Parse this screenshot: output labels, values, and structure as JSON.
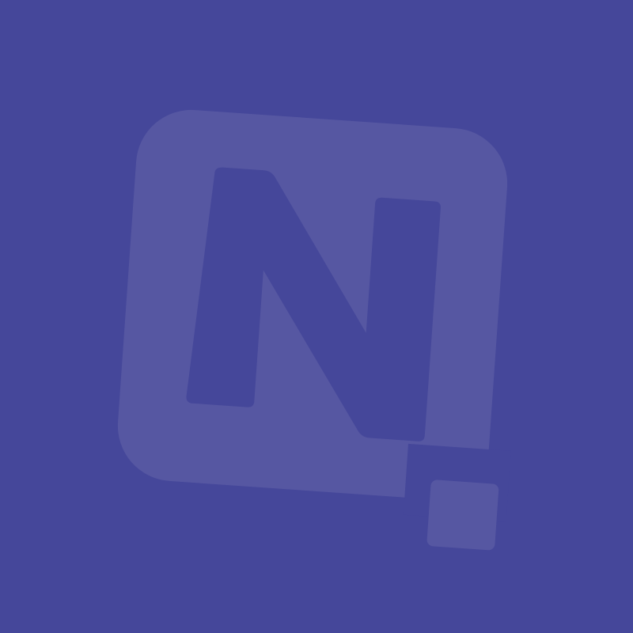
{
  "colors": {
    "background": "#45479a",
    "logo_tile": "#5657a2",
    "logo_letter": "#45479a"
  },
  "logo": {
    "icon": "n-letter-logo-icon",
    "letter": "N"
  }
}
